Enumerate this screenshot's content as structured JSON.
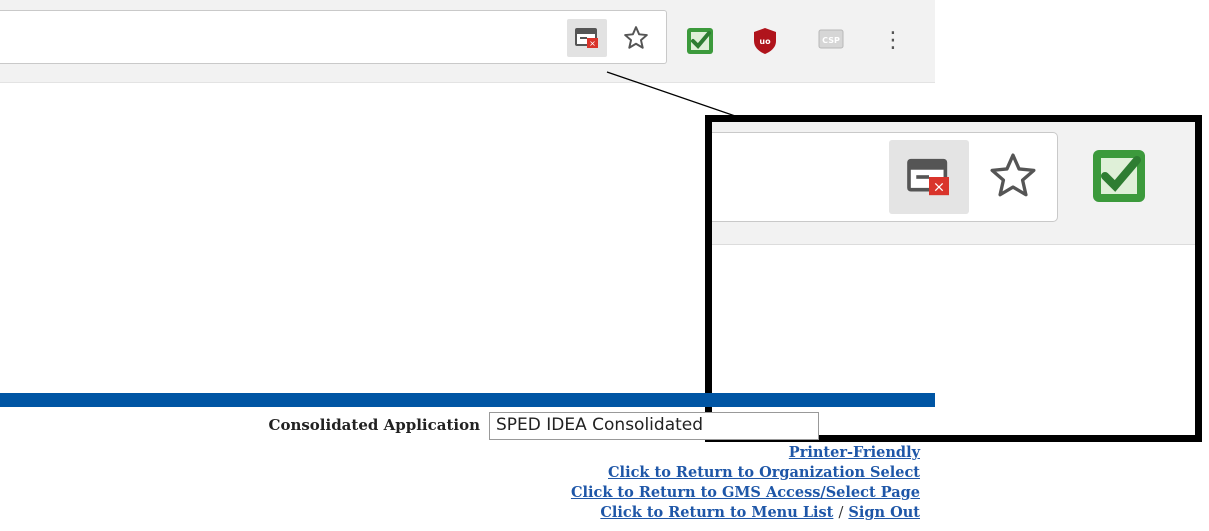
{
  "toolbar": {
    "icons": [
      "tab-icon",
      "star-icon",
      "checkmark-extension-icon",
      "ublock-icon",
      "csp-extension-icon",
      "menu-dots-icon"
    ],
    "menu_glyph": "⋮"
  },
  "inset": {
    "icons": [
      "tab-icon",
      "star-icon",
      "checkmark-extension-icon"
    ]
  },
  "page": {
    "consolidated_label": "Consolidated Application",
    "consolidated_value": "SPED IDEA Consolidated",
    "links": {
      "printer_friendly": "Printer-Friendly",
      "return_org": "Click to Return to Organization Select",
      "return_gms": "Click to Return to GMS Access/Select Page",
      "return_menu": "Click to Return to Menu List",
      "separator": "/",
      "sign_out": "Sign Out"
    }
  },
  "colors": {
    "blue_bar": "#0055a4",
    "link": "#1f57a8",
    "green_check": "#3c9a3c",
    "ublock_red": "#b0141c"
  }
}
